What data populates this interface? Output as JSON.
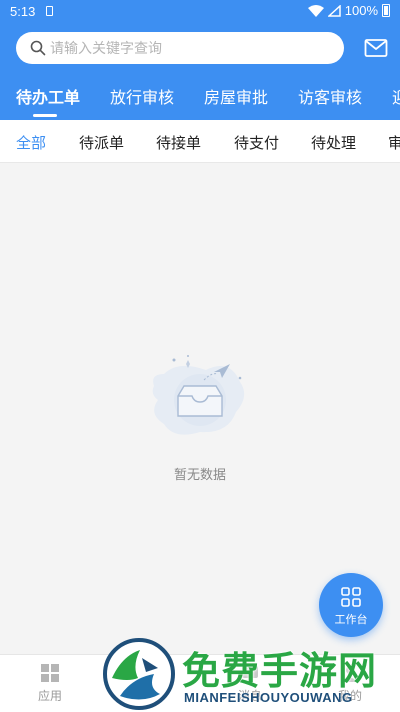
{
  "status_bar": {
    "time": "5:13",
    "battery": "100%"
  },
  "search": {
    "placeholder": "请输入关键字查询",
    "value": ""
  },
  "top_tabs": [
    {
      "label": "待办工单",
      "active": true
    },
    {
      "label": "放行审核",
      "active": false
    },
    {
      "label": "房屋审批",
      "active": false
    },
    {
      "label": "访客审核",
      "active": false
    },
    {
      "label": "迎",
      "active": false
    }
  ],
  "sub_tabs": [
    {
      "label": "全部",
      "active": true
    },
    {
      "label": "待派单",
      "active": false
    },
    {
      "label": "待接单",
      "active": false
    },
    {
      "label": "待支付",
      "active": false
    },
    {
      "label": "待处理",
      "active": false
    },
    {
      "label": "审",
      "active": false
    }
  ],
  "empty_state": {
    "message": "暂无数据"
  },
  "fab": {
    "label": "工作台"
  },
  "bottom_nav": [
    {
      "label": "应用",
      "icon": "grid-icon"
    },
    {
      "label": "动",
      "icon": "activity-icon"
    },
    {
      "label": "消息",
      "icon": "message-icon"
    },
    {
      "label": "我的",
      "icon": "user-icon"
    }
  ],
  "watermark": {
    "title": "免费手游网",
    "subtitle": "MIANFEISHOUYOUWANG"
  },
  "colors": {
    "primary": "#3d8ff2",
    "active_text": "#3d8ff2",
    "watermark_green": "#2aa745"
  }
}
